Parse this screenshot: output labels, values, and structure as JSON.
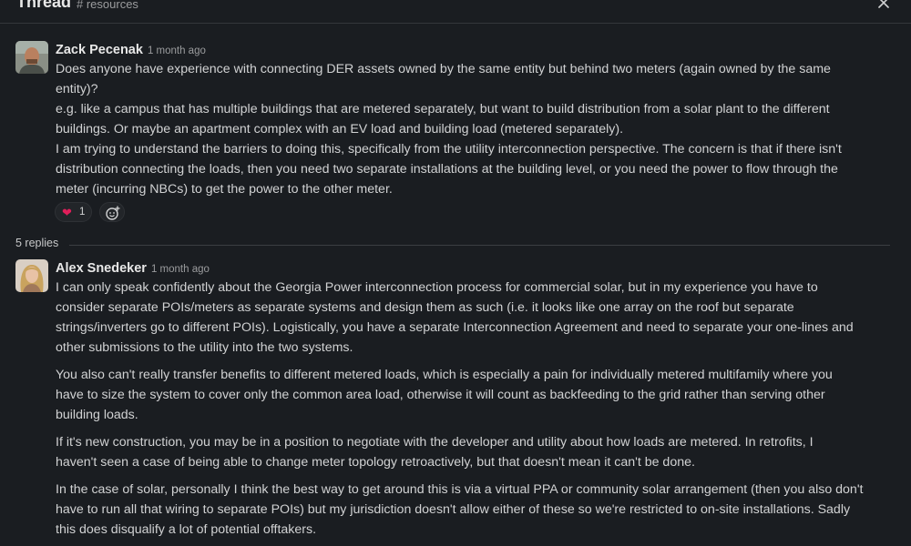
{
  "header": {
    "title": "Thread",
    "channel": "# resources"
  },
  "messages": [
    {
      "author": "Zack Pecenak",
      "time": "1 month ago",
      "lines": [
        "Does anyone have experience with connecting DER assets owned by the same entity but behind two meters (again owned by the same",
        "entity)?",
        "e.g. like a campus that has multiple buildings that are metered separately, but want to build distribution from a solar plant to the different",
        "buildings. Or maybe an apartment complex with an EV load and building load (metered separately).",
        "I am trying to understand the barriers to doing this, specifically from the utility interconnection perspective. The concern is that if there isn't",
        "distribution connecting the loads, then you need two separate installations at the building level, or you need the power to flow through the",
        "meter (incurring NBCs) to get the power to the other meter."
      ],
      "reactions": [
        {
          "emoji": "heart",
          "count": "1"
        }
      ]
    },
    {
      "author": "Alex Snedeker",
      "time": "1 month ago",
      "paragraphs": [
        [
          "I can only speak confidently about the Georgia Power interconnection process for commercial solar, but in my experience you have to",
          "consider separate POIs/meters as separate systems and design them as such (i.e. it looks like one array on the roof but separate",
          "strings/inverters go to different POIs). Logistically, you have a separate Interconnection Agreement and need to separate your one-lines and",
          "other submissions to the utility into the two systems."
        ],
        [
          "You also can't really transfer benefits to different metered loads, which is especially a pain for individually metered multifamily where you",
          "have to size the system to cover only the common area load, otherwise it will count as backfeeding to the grid rather than serving other",
          "building loads."
        ],
        [
          "If it's new construction, you may be in a position to negotiate with the developer and utility about how loads are metered. In retrofits, I",
          "haven't seen a case of being able to change meter topology retroactively, but that doesn't mean it can't be done."
        ],
        [
          "In the case of solar, personally I think the best way to get around this is via a virtual PPA or community solar arrangement (then you also don't",
          "have to run all that wiring to separate POIs) but my jurisdiction doesn't allow either of these so we're restricted to on-site installations. Sadly",
          "this does disqualify a lot of potential offtakers."
        ]
      ]
    }
  ],
  "replies": {
    "label": "5 replies"
  },
  "icons": {
    "close": "close-icon",
    "add_reaction": "add-reaction-icon",
    "heart": "heart-icon"
  },
  "colors": {
    "background": "#1a1d21",
    "text": "#d1d2d3",
    "muted": "#9b9c9e",
    "heart": "#e01e5a"
  }
}
